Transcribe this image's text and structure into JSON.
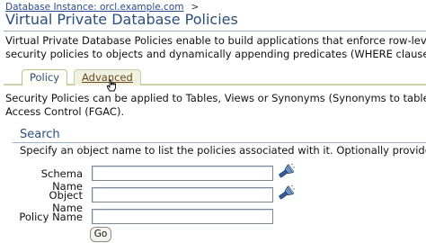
{
  "breadcrumb": {
    "link_text": "Database Instance: orcl.example.com",
    "separator": ">"
  },
  "page": {
    "title": "Virtual Private Database Policies",
    "intro_line1": "Virtual Private Database Policies enable to build applications that enforce row-level security policie",
    "intro_line2": "security policies to objects and dynamically appending predicates (WHERE clauses) to SQL statem"
  },
  "tabs": [
    {
      "label": "Policy",
      "selected": true
    },
    {
      "label": "Advanced",
      "selected": false
    }
  ],
  "policies_text": {
    "line1": "Security Policies can be applied to Tables, Views or Synonyms (Synonyms to tables and views only",
    "line2": "Access Control (FGAC)."
  },
  "search": {
    "title": "Search",
    "description": "Specify an object name to list the policies associated with it. Optionally provide a policy name te",
    "fields": [
      {
        "label": "Schema Name",
        "value": ""
      },
      {
        "label": "Object Name",
        "value": ""
      },
      {
        "label": "Policy Name",
        "value": ""
      }
    ],
    "go_label": "Go"
  },
  "colors": {
    "title_blue": "#2b4f7e",
    "link_blue": "#2a4b8d",
    "tab_border": "#c8d4a8"
  },
  "icons": {
    "lov": "flashlight-icon",
    "cursor": "hand-cursor-icon"
  }
}
